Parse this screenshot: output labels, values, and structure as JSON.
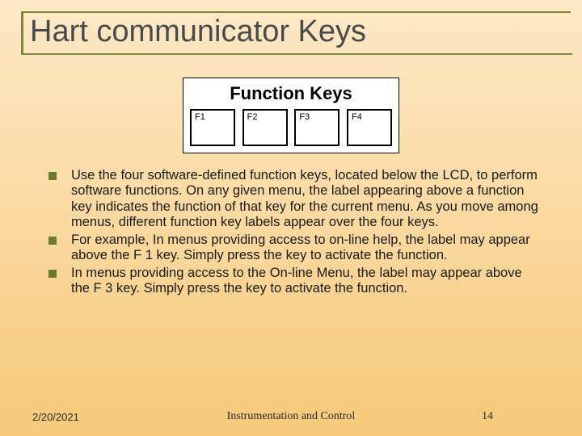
{
  "title": "Hart communicator Keys",
  "figure": {
    "heading": "Function Keys",
    "keys": [
      "F1",
      "F2",
      "F3",
      "F4"
    ]
  },
  "bullets": [
    "Use the four software-defined function keys, located below the LCD, to perform software functions. On any given menu, the label appearing above a function key indicates the function of that key for the current menu. As you move among menus, different function key labels appear over the four keys.",
    "For example, In menus providing access to on-line help, the label may appear above the F 1 key. Simply press the key to activate the function.",
    "In menus providing access to the On-line Menu, the label may appear above the F 3 key. Simply press the key to activate the function."
  ],
  "footer": {
    "date": "2/20/2021",
    "center": "Instrumentation and Control",
    "page": "14"
  }
}
